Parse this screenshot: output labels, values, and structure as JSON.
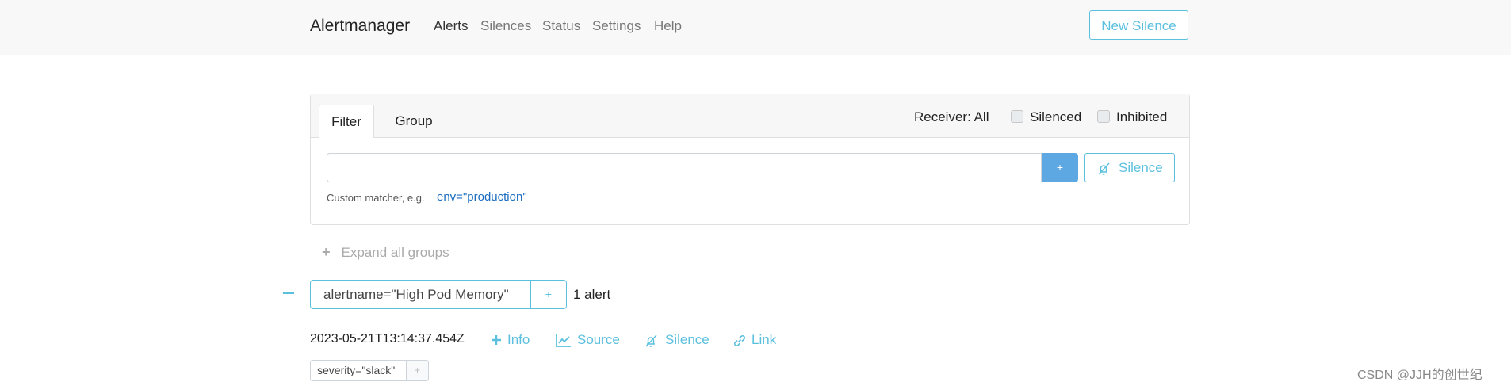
{
  "navbar": {
    "brand": "Alertmanager",
    "links": [
      "Alerts",
      "Silences",
      "Status",
      "Settings",
      "Help"
    ],
    "new_silence_label": "New Silence"
  },
  "filter": {
    "tabs": [
      "Filter",
      "Group"
    ],
    "receiver": "Receiver: All",
    "silenced_label": "Silenced",
    "inhibited_label": "Inhibited",
    "input_value": "",
    "add_button": "+",
    "silence_button": "Silence",
    "hint": "Custom matcher, e.g.",
    "hint_example": "env=\"production\""
  },
  "expand_all": "Expand all groups",
  "group": {
    "label": "alertname=\"High Pod Memory\"",
    "add_button": "+",
    "count": "1 alert"
  },
  "alert": {
    "timestamp": "2023-05-21T13:14:37.454Z",
    "actions": {
      "info": "Info",
      "source": "Source",
      "silence": "Silence",
      "link": "Link"
    },
    "labels": [
      {
        "text": "severity=\"slack\"",
        "add": "+"
      }
    ]
  },
  "watermark": "CSDN @JJH的创世纪",
  "colors": {
    "accent": "#5bc0de",
    "primary": "#5da8e2",
    "link": "#1b6dc1"
  }
}
